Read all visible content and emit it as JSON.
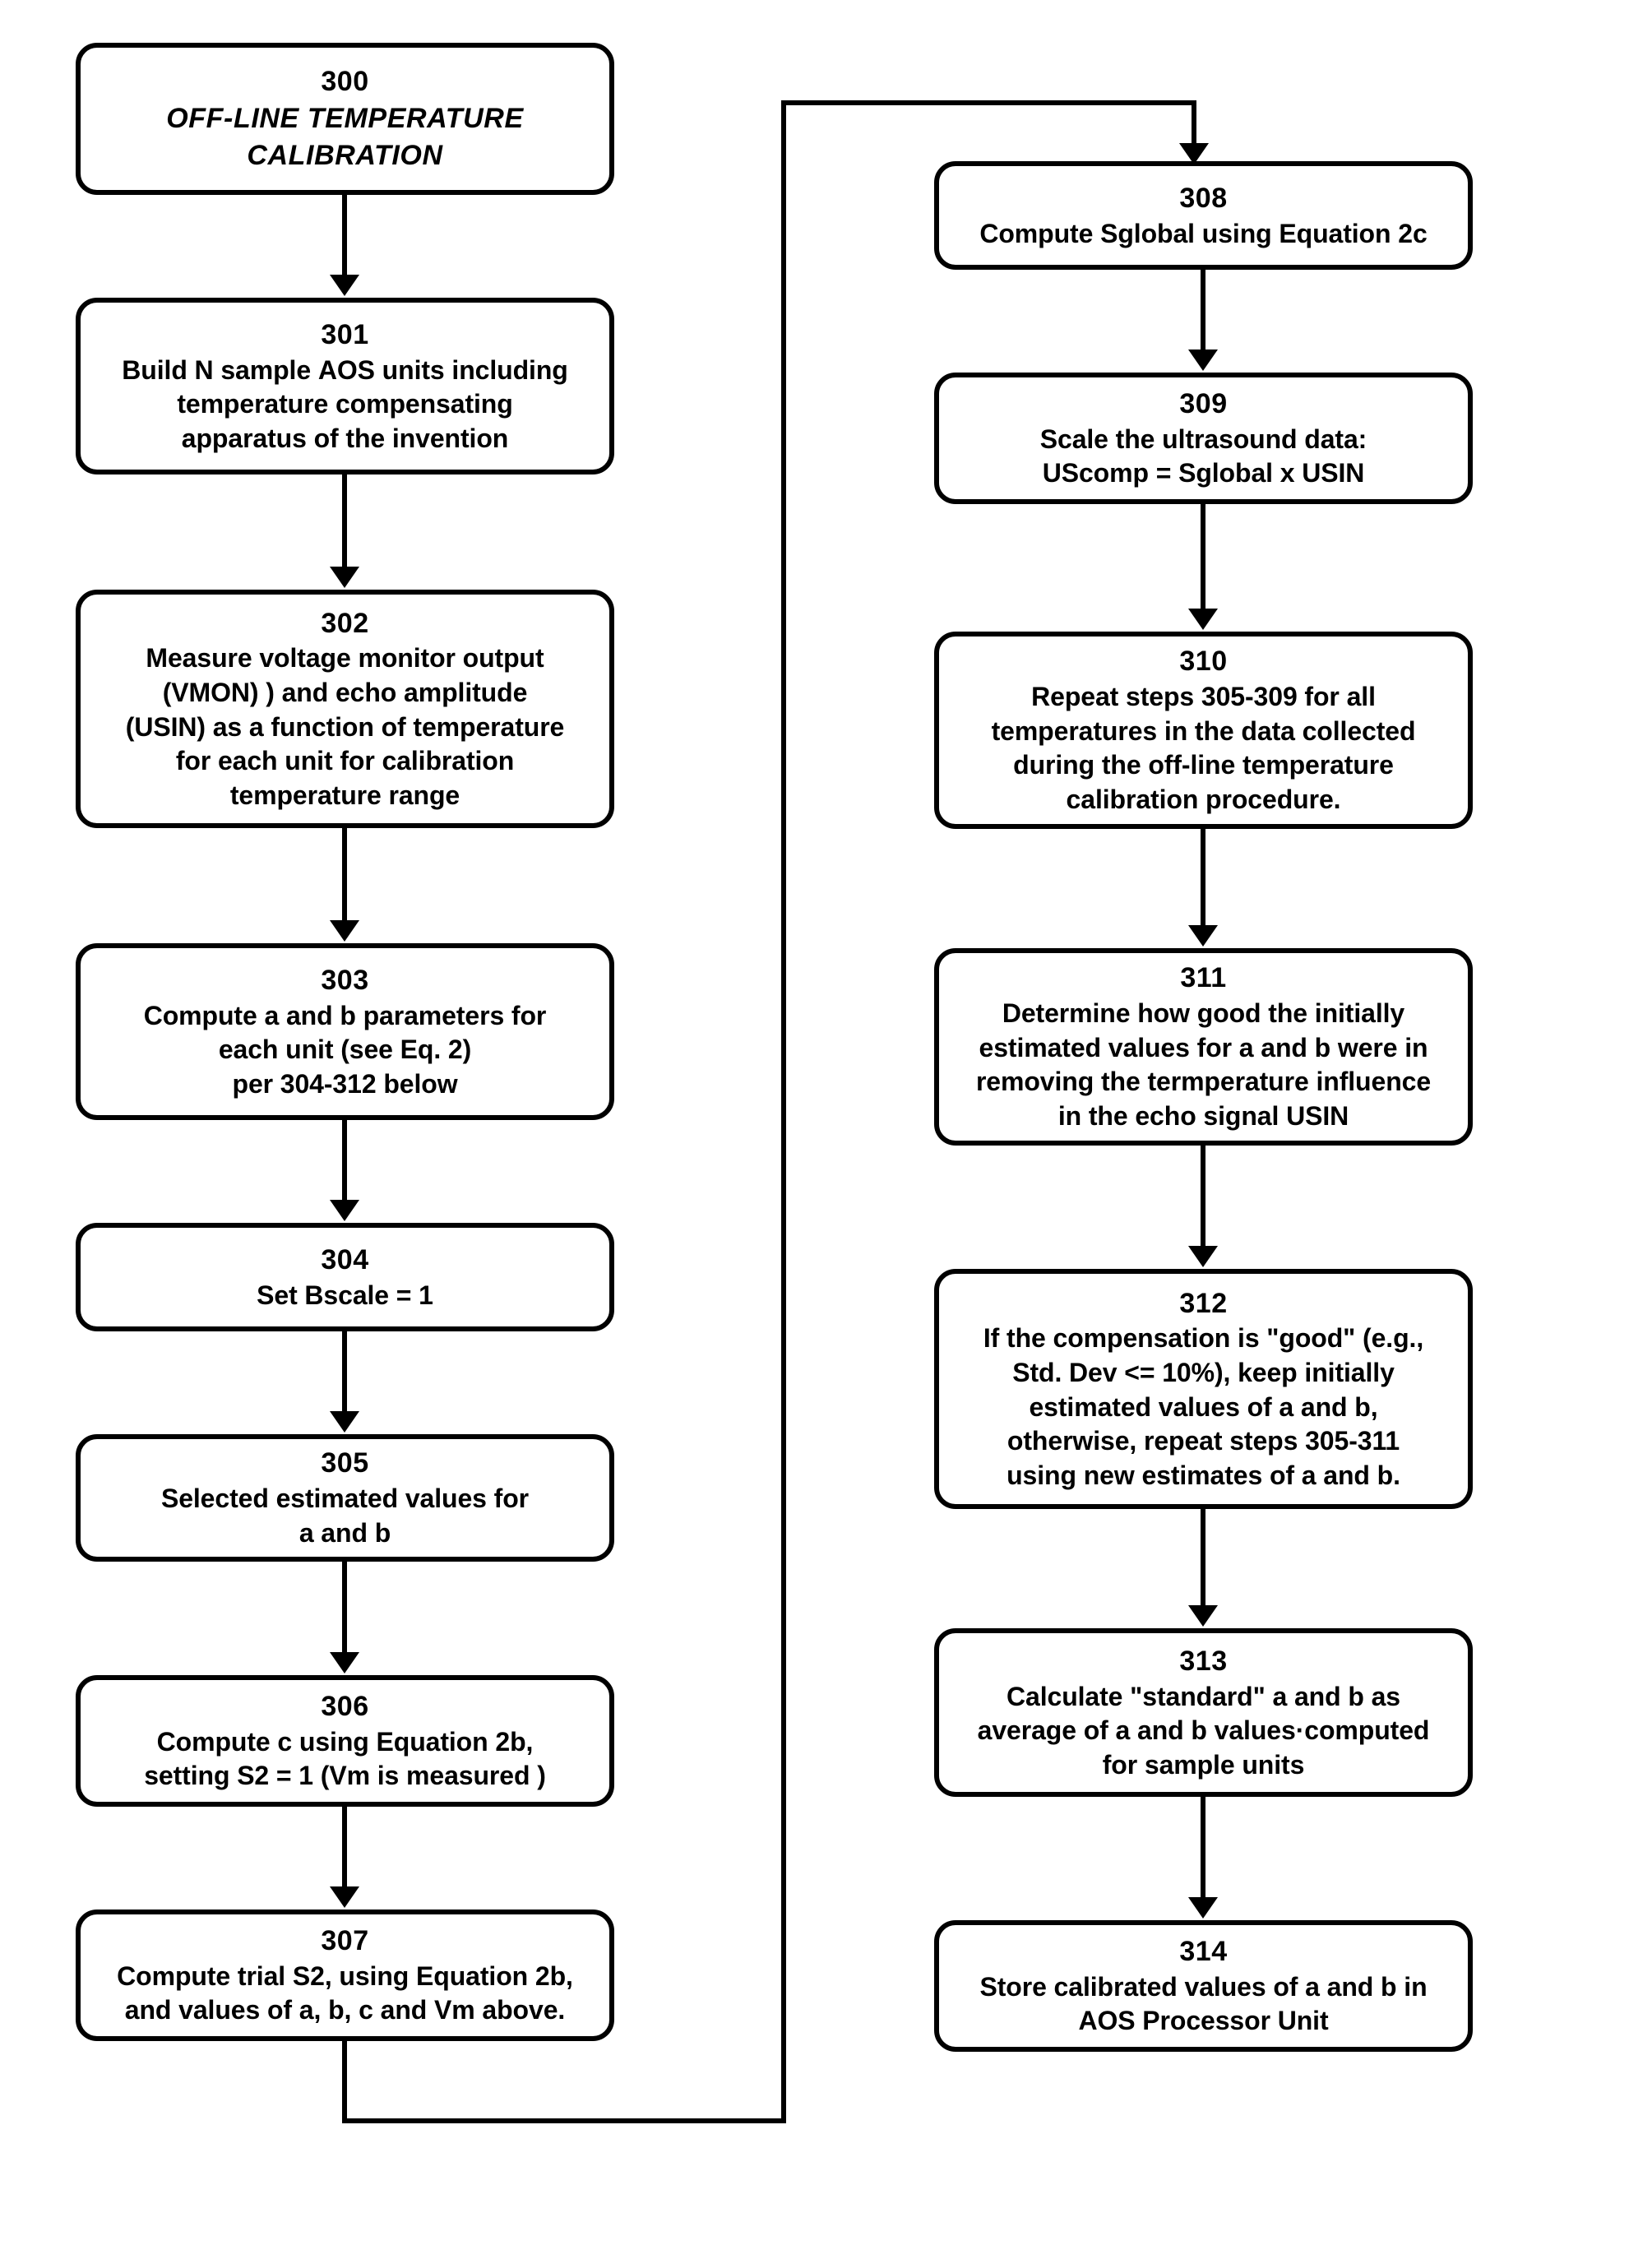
{
  "diagram": {
    "title": "OFF-LINE TEMPERATURE CALIBRATION",
    "kind": "flowchart"
  },
  "nodes": {
    "n300": {
      "number": "300",
      "text": "OFF-LINE TEMPERATURE\nCALIBRATION"
    },
    "n301": {
      "number": "301",
      "text": "Build N sample AOS units including\ntemperature compensating\napparatus of the invention"
    },
    "n302": {
      "number": "302",
      "text": "Measure voltage monitor output\n(VMON) ) and echo amplitude\n(USIN) as a function of temperature\nfor each unit for calibration\ntemperature range"
    },
    "n303": {
      "number": "303",
      "text": "Compute a and b parameters for\neach unit (see Eq. 2)\nper 304-312 below"
    },
    "n304": {
      "number": "304",
      "text": "Set Bscale = 1"
    },
    "n305": {
      "number": "305",
      "text": "Selected estimated values for\na and b"
    },
    "n306": {
      "number": "306",
      "text": "Compute c using Equation 2b,\nsetting S2 = 1 (Vm is measured )"
    },
    "n307": {
      "number": "307",
      "text": "Compute trial S2, using Equation 2b,\nand values of a, b, c and Vm above."
    },
    "n308": {
      "number": "308",
      "text": "Compute Sglobal using Equation 2c"
    },
    "n309": {
      "number": "309",
      "text": "Scale the ultrasound data:\nUScomp = Sglobal x USIN"
    },
    "n310": {
      "number": "310",
      "text": "Repeat steps 305-309 for all\ntemperatures in the data collected\nduring the off-line temperature\ncalibration procedure."
    },
    "n311": {
      "number": "311",
      "text": "Determine how good the initially\nestimated values for a and b were in\nremoving the termperature influence\nin the echo signal USIN"
    },
    "n312": {
      "number": "312",
      "text": "If the compensation is \"good\" (e.g.,\nStd. Dev <= 10%), keep  initially\nestimated values of a and b,\notherwise, repeat steps 305-311\nusing new estimates of a and b."
    },
    "n313": {
      "number": "313",
      "text": "Calculate \"standard\" a and b as\naverage of a and b values·computed\nfor sample units"
    },
    "n314": {
      "number": "314",
      "text": "Store calibrated values of a and b in\nAOS Processor Unit"
    }
  },
  "edges": [
    {
      "name": "edge-300-to-301",
      "from": "300",
      "to": "301"
    },
    {
      "name": "edge-301-to-302",
      "from": "301",
      "to": "302"
    },
    {
      "name": "edge-302-to-303",
      "from": "302",
      "to": "303"
    },
    {
      "name": "edge-303-to-304",
      "from": "303",
      "to": "304"
    },
    {
      "name": "edge-304-to-305",
      "from": "304",
      "to": "305"
    },
    {
      "name": "edge-305-to-306",
      "from": "305",
      "to": "306"
    },
    {
      "name": "edge-306-to-307",
      "from": "306",
      "to": "307"
    },
    {
      "name": "edge-307-to-308",
      "from": "307",
      "to": "308"
    },
    {
      "name": "edge-308-to-309",
      "from": "308",
      "to": "309"
    },
    {
      "name": "edge-309-to-310",
      "from": "309",
      "to": "310"
    },
    {
      "name": "edge-310-to-311",
      "from": "310",
      "to": "311"
    },
    {
      "name": "edge-311-to-312",
      "from": "311",
      "to": "312"
    },
    {
      "name": "edge-312-to-313",
      "from": "312",
      "to": "313"
    },
    {
      "name": "edge-313-to-314",
      "from": "313",
      "to": "314"
    }
  ],
  "colors": {
    "stroke": "#000000",
    "background": "#ffffff",
    "text": "#000000"
  }
}
